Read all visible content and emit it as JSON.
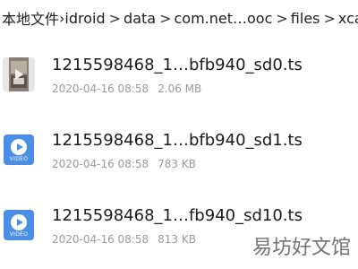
{
  "breadcrumb": {
    "items": [
      "本地文件",
      "›idroid",
      "data",
      "com.net…ooc",
      "files",
      "xcache"
    ],
    "separator": ">"
  },
  "files": [
    {
      "name": "1215598468_1…bfb940_sd0.ts",
      "date": "2020-04-16 08:58",
      "size": "2.06 MB",
      "icon": "video-thumbnail-icon"
    },
    {
      "name": "1215598468_1…bfb940_sd1.ts",
      "date": "2020-04-16 08:58",
      "size": "783 KB",
      "icon": "video-file-icon",
      "icon_label": "VIDEO"
    },
    {
      "name": "1215598468_1…fb940_sd10.ts",
      "date": "2020-04-16 08:58",
      "size": "813 KB",
      "icon": "video-file-icon",
      "icon_label": "VIDEO"
    }
  ],
  "watermark": "易坊好文馆",
  "colors": {
    "icon_blue": "#4a8ee6",
    "meta_gray": "#9a9a9a",
    "text": "#1b1b1b"
  }
}
